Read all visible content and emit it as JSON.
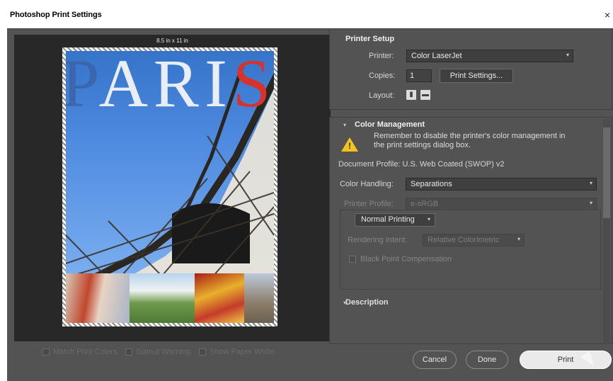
{
  "window": {
    "title": "Photoshop Print Settings",
    "close": "×"
  },
  "preview": {
    "paper_size": "8.5 in x 11 in",
    "title_text": "PARIS",
    "options": [
      {
        "label": "Match Print Colors"
      },
      {
        "label": "Gamut Warning"
      },
      {
        "label": "Show Paper White"
      }
    ]
  },
  "printer_setup": {
    "title": "Printer Setup",
    "printer_label": "Printer:",
    "printer_value": "Color LaserJet",
    "copies_label": "Copies:",
    "copies_value": "1",
    "print_settings_btn": "Print Settings...",
    "layout_label": "Layout:"
  },
  "color_management": {
    "title": "Color Management",
    "warning": "Remember to disable the printer's color management in the print settings dialog box.",
    "doc_profile": "Document Profile: U.S. Web Coated (SWOP) v2",
    "color_handling_label": "Color Handling:",
    "color_handling_value": "Separations",
    "printer_profile_label": "Printer Profile:",
    "printer_profile_value": "e-sRGB",
    "normal_printing": "Normal Printing",
    "rendering_intent_label": "Rendering Intent:",
    "rendering_intent_value": "Relative Colorimetric",
    "black_point": "Black Point Compensation"
  },
  "description": {
    "title": "Description"
  },
  "buttons": {
    "cancel": "Cancel",
    "done": "Done",
    "print": "Print"
  }
}
